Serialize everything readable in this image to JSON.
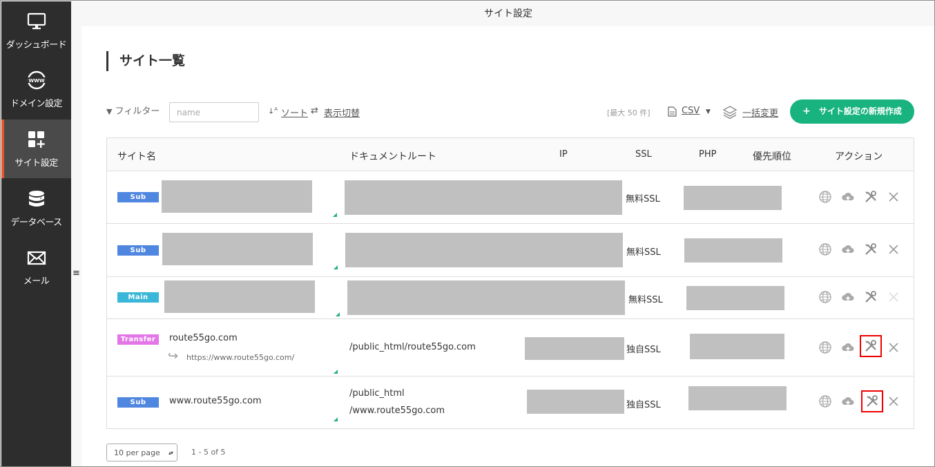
{
  "window_title": "サイト設定",
  "sidebar": {
    "items": [
      {
        "label": "ダッシュボード",
        "icon": "monitor-icon"
      },
      {
        "label": "ドメイン設定",
        "icon": "www-globe-icon"
      },
      {
        "label": "サイト設定",
        "icon": "grid-plus-icon",
        "active": true
      },
      {
        "label": "データベース",
        "icon": "database-icon"
      },
      {
        "label": "メール",
        "icon": "envelope-icon"
      }
    ]
  },
  "page_title": "サイト一覧",
  "toolbar": {
    "filter_label": "フィルター",
    "filter_placeholder": "name",
    "sort_label": "ソート",
    "display_toggle_label": "表示切替",
    "max_count": "[最大 50 件]",
    "csv_label": "CSV",
    "bulk_change_label": "一括変更",
    "new_button_label": "サイト設定の新規作成"
  },
  "table": {
    "headers": {
      "site_name": "サイト名",
      "document_root": "ドキュメントルート",
      "ip": "IP",
      "ssl": "SSL",
      "php": "PHP",
      "priority": "優先順位",
      "action": "アクション"
    },
    "rows": [
      {
        "badge": "Sub",
        "site": "",
        "redirect": "",
        "docroot": "",
        "ssl": "無料SSL"
      },
      {
        "badge": "Sub",
        "site": "",
        "redirect": "",
        "docroot": "",
        "ssl": "無料SSL"
      },
      {
        "badge": "Main",
        "site": "",
        "redirect": "",
        "docroot": "",
        "ssl": "無料SSL"
      },
      {
        "badge": "Transfer",
        "site": "route55go.com",
        "redirect": "https://www.route55go.com/",
        "docroot": "/public_html/route55go.com",
        "ssl": "独自SSL"
      },
      {
        "badge": "Sub",
        "site": "www.route55go.com",
        "redirect": "",
        "docroot_line1": "/public_html",
        "docroot_line2": "/www.route55go.com",
        "ssl": "独自SSL"
      }
    ]
  },
  "footer": {
    "per_page": "10 per page",
    "paging": "1 - 5 of 5"
  },
  "colors": {
    "sidebar_bg": "#2d2d2d",
    "active_accent": "#e8562a",
    "primary_button": "#19b37f",
    "badge_sub": "#4f86e0",
    "badge_main": "#3ab7d8",
    "badge_transfer": "#e276e6",
    "highlight": "#ee0000"
  }
}
